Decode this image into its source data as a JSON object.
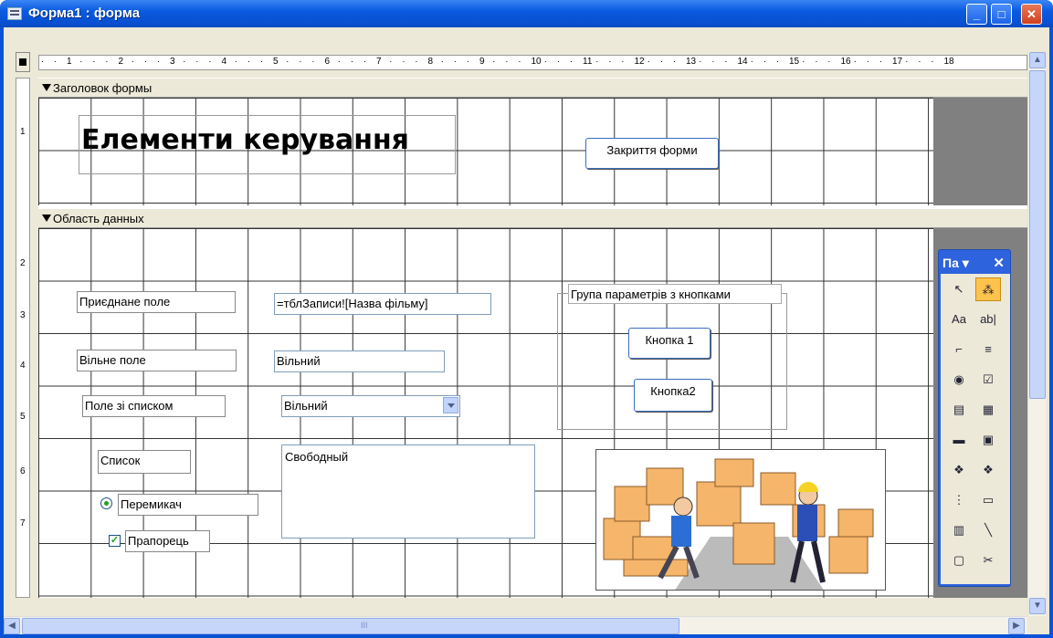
{
  "window": {
    "title": "Форма1 : форма",
    "minimize": "_",
    "maximize": "□",
    "close": "✕"
  },
  "ruler": {
    "h_marks": [
      "1",
      "2",
      "3",
      "4",
      "5",
      "6",
      "7",
      "8",
      "9",
      "10",
      "11",
      "12",
      "13",
      "14",
      "15",
      "16",
      "17",
      "18"
    ],
    "v_marks": [
      "1",
      "2",
      "3",
      "4",
      "5",
      "6",
      "7"
    ]
  },
  "sections": {
    "header": "Заголовок формы",
    "detail": "Область данных"
  },
  "header_controls": {
    "title": "Елементи керування",
    "close_button": "Закриття форми"
  },
  "detail_controls": {
    "bound_label": "Приєднане поле",
    "bound_value": "=тблЗаписи![Назва фільму]",
    "free_label": "Вільне поле",
    "free_value": "Вільний",
    "combo_label": "Поле зі списком",
    "combo_value": "Вільний",
    "list_label": "Список",
    "list_value": "Свободный",
    "radio_label": "Перемикач",
    "check_label": "Прапорець",
    "group_label": "Група параметрів з кнопками",
    "button1": "Кнопка 1",
    "button2": "Кнопка2"
  },
  "toolbox": {
    "title": "Па ▾",
    "close": "✕",
    "tools": [
      {
        "icon": "pointer-icon",
        "glyph": "↖"
      },
      {
        "icon": "wizard-icon",
        "glyph": "⁂"
      },
      {
        "icon": "label-icon",
        "glyph": "Aa"
      },
      {
        "icon": "textbox-icon",
        "glyph": "ab|"
      },
      {
        "icon": "option-group-icon",
        "glyph": "⌐"
      },
      {
        "icon": "toggle-icon",
        "glyph": "≡"
      },
      {
        "icon": "option-icon",
        "glyph": "◉"
      },
      {
        "icon": "checkbox-icon",
        "glyph": "☑"
      },
      {
        "icon": "combobox-icon",
        "glyph": "▤"
      },
      {
        "icon": "listbox-icon",
        "glyph": "▦"
      },
      {
        "icon": "button-icon",
        "glyph": "▬"
      },
      {
        "icon": "image-icon",
        "glyph": "▣"
      },
      {
        "icon": "unbound-object-icon",
        "glyph": "❖"
      },
      {
        "icon": "bound-object-icon",
        "glyph": "❖"
      },
      {
        "icon": "page-break-icon",
        "glyph": "⋮"
      },
      {
        "icon": "tab-control-icon",
        "glyph": "▭"
      },
      {
        "icon": "subform-icon",
        "glyph": "▥"
      },
      {
        "icon": "line-icon",
        "glyph": "╲"
      },
      {
        "icon": "rectangle-icon",
        "glyph": "▢"
      },
      {
        "icon": "more-controls-icon",
        "glyph": "✂"
      }
    ]
  },
  "scroll": {
    "up": "▲",
    "down": "▼",
    "left": "◀",
    "right": "▶",
    "grip": "III"
  }
}
